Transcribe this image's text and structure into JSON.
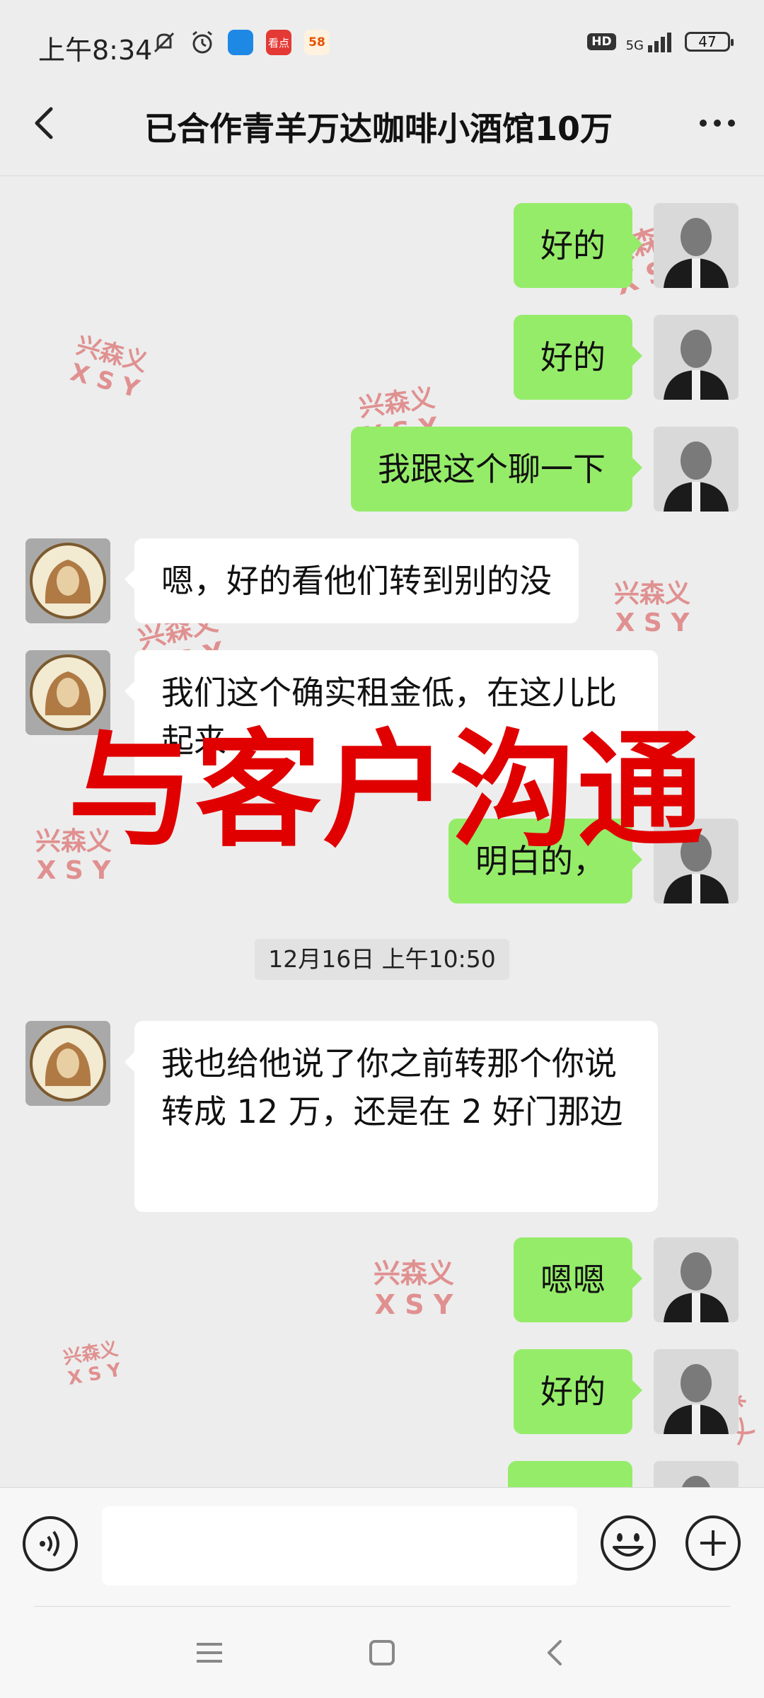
{
  "status_bar": {
    "time": "上午8:34",
    "app_kandian": "看点",
    "app_58": "58",
    "hd": "HD",
    "network": "5G",
    "battery": "47"
  },
  "header": {
    "title": "已合作青羊万达咖啡小酒馆10万"
  },
  "messages": [
    {
      "side": "me",
      "text": "好的"
    },
    {
      "side": "me",
      "text": "好的"
    },
    {
      "side": "me",
      "text": "我跟这个聊一下"
    },
    {
      "side": "other",
      "text": "嗯，好的看他们转到别的没"
    },
    {
      "side": "other",
      "text": "我们这个确实租金低，在这儿比起来"
    },
    {
      "side": "me",
      "text": "明白的，"
    },
    {
      "side": "other",
      "text": "我也给他说了你之前转那个你说转成 12 万，还是在 2 好门那边"
    },
    {
      "side": "me",
      "text": "嗯嗯"
    },
    {
      "side": "me",
      "text": "好的"
    }
  ],
  "timestamp": "12月16日 上午10:50",
  "watermark": {
    "name": "兴森义",
    "code": "X S Y"
  },
  "overlay_text": "与客户沟通",
  "colors": {
    "background": "#ededed",
    "my_bubble": "#95ec69",
    "other_bubble": "#ffffff",
    "overlay_red": "#e00000",
    "watermark_red": "#d64545"
  },
  "icons": {
    "back": "chevron-left-icon",
    "more": "more-dots-icon",
    "voice": "voice-icon",
    "emoji": "emoji-icon",
    "plus": "plus-icon",
    "nav_menu": "menu-icon",
    "nav_home": "home-icon",
    "nav_back": "back-icon"
  }
}
